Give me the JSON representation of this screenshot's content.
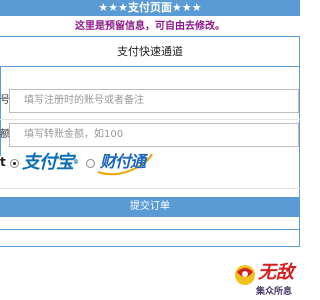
{
  "header": {
    "banner": "★★★支付页面★★★",
    "notice": "这里是预留信息，可自由去修改。"
  },
  "form": {
    "title": "支付快速通道",
    "account": {
      "label": "号",
      "placeholder": "填写注册时的账号或者备注"
    },
    "amount": {
      "label": "额",
      "placeholder": "填写转账金额，如100"
    },
    "payment": {
      "prefix": "t",
      "options": [
        {
          "name": "alipay",
          "logo_text": "支付宝",
          "selected": true
        },
        {
          "name": "tenpay",
          "logo_text": "财付通",
          "selected": false
        }
      ]
    },
    "submit_label": "提交订单"
  },
  "watermark": {
    "chars": "无敌",
    "sub": "集众所息"
  },
  "colors": {
    "accent": "#5b9bd5",
    "notice": "#8b1a8b",
    "alipay": "#0d6fb8",
    "tenpay": "#1a66c0"
  }
}
